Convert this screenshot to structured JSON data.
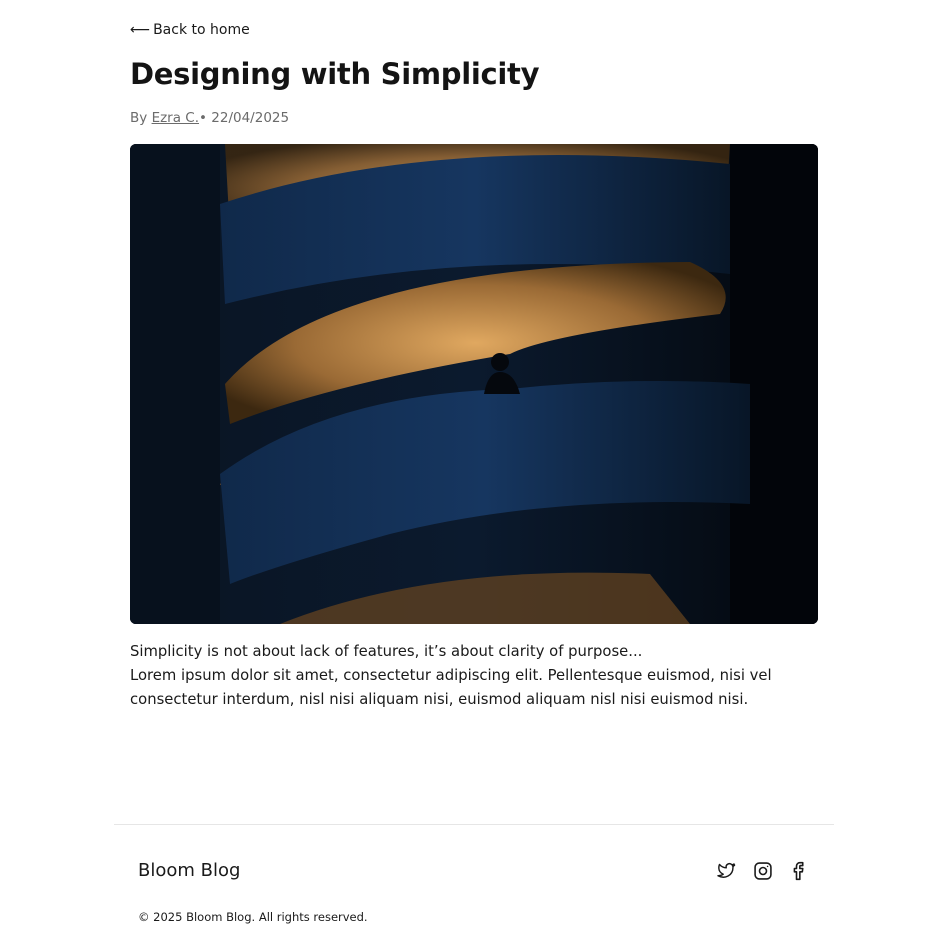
{
  "nav": {
    "back_label": "Back to home",
    "back_icon": "arrow-left-icon"
  },
  "post": {
    "title": "Designing with Simplicity",
    "by_label": "By",
    "author": "Ezra C.",
    "separator": "•",
    "date": "22/04/2025",
    "hero_image": "spiral-staircase-photo",
    "body": [
      "Simplicity is not about lack of features, it’s about clarity of purpose...",
      "Lorem ipsum dolor sit amet, consectetur adipiscing elit. Pellentesque euismod, nisi vel consectetur interdum, nisl nisi aliquam nisi, euismod aliquam nisl nisi euismod nisi."
    ]
  },
  "footer": {
    "brand": "Bloom Blog",
    "copyright": "© 2025 Bloom Blog. All rights reserved.",
    "socials": [
      {
        "name": "twitter-icon"
      },
      {
        "name": "instagram-icon"
      },
      {
        "name": "facebook-icon"
      }
    ]
  },
  "colors": {
    "text": "#1a1a1a",
    "muted": "#6b6b6b",
    "divider": "#e6e6e6"
  }
}
